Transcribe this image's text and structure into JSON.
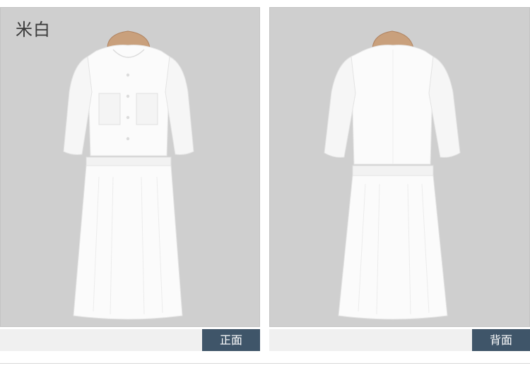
{
  "color_name": "米白",
  "views": {
    "front_label": "正面",
    "back_label": "背面"
  },
  "colors": {
    "background_gray": "#cfcfcf",
    "tag_blue": "#3f5569",
    "dress_white": "#fbfbfb"
  }
}
